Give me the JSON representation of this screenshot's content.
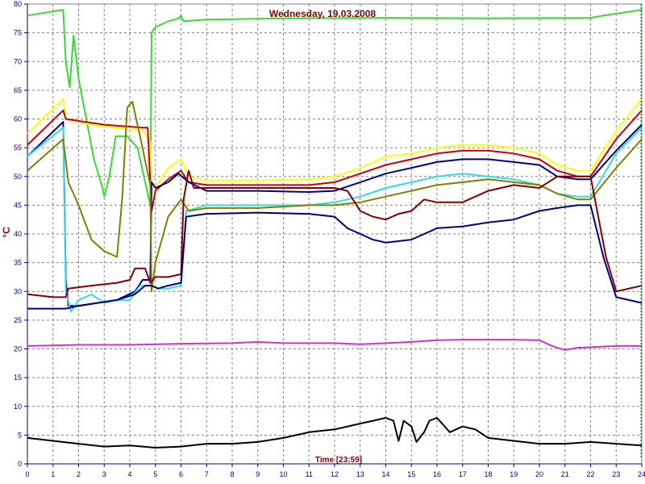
{
  "chart_data": {
    "type": "line",
    "title": "Wednesday, 19.03.2008",
    "xlabel": "Time [23:59]",
    "ylabel": "°C",
    "xlim": [
      0,
      24
    ],
    "ylim": [
      0,
      80
    ],
    "x_ticks": [
      0,
      1,
      2,
      3,
      4,
      5,
      6,
      7,
      8,
      9,
      10,
      11,
      12,
      13,
      14,
      15,
      16,
      17,
      18,
      19,
      20,
      21,
      22,
      23,
      24
    ],
    "y_ticks": [
      0,
      5,
      10,
      15,
      20,
      25,
      30,
      35,
      40,
      45,
      50,
      55,
      60,
      65,
      70,
      75,
      80
    ],
    "grid": true,
    "colors": {
      "grid": "#808080",
      "axis": "#000080",
      "title": "#800000",
      "marker": "#008000"
    },
    "series": [
      {
        "color": "#33dd33",
        "points": [
          [
            0,
            78
          ],
          [
            1.4,
            79
          ],
          [
            1.5,
            70
          ],
          [
            1.65,
            65.5
          ],
          [
            1.8,
            74.5
          ],
          [
            2.0,
            67
          ],
          [
            2.6,
            53
          ],
          [
            2.9,
            48.5
          ],
          [
            3.0,
            46.5
          ],
          [
            3.2,
            50
          ],
          [
            3.45,
            57
          ],
          [
            3.9,
            57
          ],
          [
            4.3,
            55
          ],
          [
            4.6,
            49
          ],
          [
            4.8,
            45
          ],
          [
            4.85,
            75
          ],
          [
            5.0,
            76
          ],
          [
            5.5,
            77
          ],
          [
            5.9,
            77.5
          ],
          [
            6.0,
            78
          ],
          [
            6.1,
            77
          ],
          [
            7,
            77.3
          ],
          [
            10,
            77.5
          ],
          [
            14,
            77.6
          ],
          [
            18,
            77.5
          ],
          [
            22,
            77.6
          ],
          [
            22.5,
            78
          ],
          [
            24,
            79
          ]
        ]
      },
      {
        "color": "#ffff00",
        "points": [
          [
            0,
            57.5
          ],
          [
            1.4,
            63.5
          ],
          [
            1.5,
            60
          ],
          [
            2.5,
            59
          ],
          [
            3.5,
            58.5
          ],
          [
            4.5,
            58
          ],
          [
            4.8,
            56
          ],
          [
            4.85,
            47
          ],
          [
            5.0,
            48
          ],
          [
            5.5,
            51.5
          ],
          [
            6.0,
            53
          ],
          [
            6.3,
            50
          ],
          [
            7,
            49.3
          ],
          [
            9,
            49.3
          ],
          [
            11,
            49.5
          ],
          [
            12,
            50
          ],
          [
            13,
            51.5
          ],
          [
            14,
            53.5
          ],
          [
            15,
            54
          ],
          [
            16,
            55
          ],
          [
            17,
            55.5
          ],
          [
            18,
            55.5
          ],
          [
            19,
            55
          ],
          [
            20,
            54
          ],
          [
            20.7,
            52
          ],
          [
            21.5,
            51
          ],
          [
            22,
            51
          ],
          [
            23,
            58
          ],
          [
            24,
            63.5
          ]
        ]
      },
      {
        "color": "#cc0000",
        "points": [
          [
            0,
            55.5
          ],
          [
            1.4,
            61.5
          ],
          [
            1.5,
            60
          ],
          [
            3,
            59
          ],
          [
            4.5,
            58.5
          ],
          [
            4.7,
            58.5
          ],
          [
            4.85,
            44
          ],
          [
            5.0,
            47.5
          ],
          [
            5.5,
            49.5
          ],
          [
            6.0,
            51
          ],
          [
            6.3,
            49
          ],
          [
            7,
            48.5
          ],
          [
            9,
            48.5
          ],
          [
            11,
            48.5
          ],
          [
            12,
            49
          ],
          [
            13,
            50.5
          ],
          [
            14,
            52
          ],
          [
            15,
            53
          ],
          [
            16,
            54
          ],
          [
            17,
            54.5
          ],
          [
            18,
            54.5
          ],
          [
            19,
            54
          ],
          [
            20,
            53
          ],
          [
            20.7,
            51
          ],
          [
            21.5,
            50
          ],
          [
            22,
            50
          ],
          [
            23,
            56.5
          ],
          [
            24,
            61.5
          ]
        ]
      },
      {
        "color": "#00008b",
        "points": [
          [
            0,
            53.5
          ],
          [
            1.4,
            59.5
          ],
          [
            1.5,
            32
          ],
          [
            1.6,
            27.5
          ],
          [
            2,
            27.5
          ],
          [
            3.5,
            28.5
          ],
          [
            4.2,
            30
          ],
          [
            4.5,
            32
          ],
          [
            4.8,
            32
          ],
          [
            4.85,
            49
          ],
          [
            5.0,
            48
          ],
          [
            5.5,
            49
          ],
          [
            5.9,
            50.5
          ],
          [
            6.3,
            49
          ],
          [
            7,
            47.5
          ],
          [
            9,
            47.5
          ],
          [
            11,
            47.3
          ],
          [
            12,
            47.5
          ],
          [
            13,
            49
          ],
          [
            14,
            50.5
          ],
          [
            15,
            51.5
          ],
          [
            16,
            52.5
          ],
          [
            17,
            53
          ],
          [
            18,
            53
          ],
          [
            19,
            52.5
          ],
          [
            20,
            52
          ],
          [
            20.7,
            50
          ],
          [
            21.5,
            49.5
          ],
          [
            22,
            49.5
          ],
          [
            23,
            54.5
          ],
          [
            24,
            59
          ]
        ]
      },
      {
        "color": "#33dddd",
        "points": [
          [
            0,
            53.5
          ],
          [
            1.4,
            58.5
          ],
          [
            1.5,
            30
          ],
          [
            1.7,
            26.5
          ],
          [
            2,
            28.5
          ],
          [
            2.5,
            29.5
          ],
          [
            3,
            28
          ],
          [
            3.5,
            28.5
          ],
          [
            4.0,
            28.5
          ],
          [
            4.4,
            31
          ],
          [
            4.8,
            31
          ],
          [
            4.85,
            31
          ],
          [
            5.1,
            30.5
          ],
          [
            5.5,
            30.5
          ],
          [
            6.0,
            31
          ],
          [
            6.2,
            44
          ],
          [
            7,
            45
          ],
          [
            9,
            45
          ],
          [
            11,
            45
          ],
          [
            12,
            45.5
          ],
          [
            13,
            46.5
          ],
          [
            14,
            48
          ],
          [
            15,
            49
          ],
          [
            16,
            50
          ],
          [
            17,
            50.5
          ],
          [
            18,
            50
          ],
          [
            19,
            49.5
          ],
          [
            20,
            48.5
          ],
          [
            20.7,
            47
          ],
          [
            21.5,
            46.5
          ],
          [
            22,
            46.5
          ],
          [
            23,
            54
          ],
          [
            24,
            58.5
          ]
        ]
      },
      {
        "color": "#808000",
        "points": [
          [
            0,
            51
          ],
          [
            1.4,
            56.5
          ],
          [
            1.6,
            49
          ],
          [
            2,
            45
          ],
          [
            2.5,
            39
          ],
          [
            3.0,
            37
          ],
          [
            3.5,
            36
          ],
          [
            3.7,
            46
          ],
          [
            3.9,
            62
          ],
          [
            4.1,
            63
          ],
          [
            4.4,
            57
          ],
          [
            4.8,
            48.5
          ],
          [
            4.85,
            30
          ],
          [
            5.0,
            35
          ],
          [
            5.5,
            43
          ],
          [
            6.0,
            46
          ],
          [
            6.3,
            44
          ],
          [
            7,
            44.5
          ],
          [
            9,
            44.5
          ],
          [
            11,
            45
          ],
          [
            12,
            45
          ],
          [
            13,
            45.5
          ],
          [
            14,
            46.5
          ],
          [
            15,
            47.5
          ],
          [
            16,
            48.5
          ],
          [
            17,
            49
          ],
          [
            18,
            49.5
          ],
          [
            19,
            49
          ],
          [
            20,
            48.5
          ],
          [
            20.7,
            47
          ],
          [
            21.5,
            46
          ],
          [
            22,
            46
          ],
          [
            23,
            51.5
          ],
          [
            24,
            56.5
          ]
        ]
      },
      {
        "color": "#800000",
        "points": [
          [
            0,
            29.5
          ],
          [
            1.0,
            29
          ],
          [
            1.5,
            29
          ],
          [
            1.6,
            30.5
          ],
          [
            2.5,
            31
          ],
          [
            3.5,
            31.5
          ],
          [
            4.0,
            32
          ],
          [
            4.2,
            34
          ],
          [
            4.6,
            34
          ],
          [
            4.8,
            31.5
          ],
          [
            5.0,
            32.5
          ],
          [
            5.5,
            32.5
          ],
          [
            6.0,
            33
          ],
          [
            6.1,
            46
          ],
          [
            6.3,
            51
          ],
          [
            6.5,
            48
          ],
          [
            7,
            48
          ],
          [
            9,
            48
          ],
          [
            11,
            48
          ],
          [
            12,
            48
          ],
          [
            12.5,
            47.5
          ],
          [
            13,
            44
          ],
          [
            13.5,
            43
          ],
          [
            14,
            42.5
          ],
          [
            14.5,
            43.5
          ],
          [
            15,
            44
          ],
          [
            15.5,
            46
          ],
          [
            16,
            45.5
          ],
          [
            17,
            45.5
          ],
          [
            17.5,
            46.5
          ],
          [
            18,
            47.5
          ],
          [
            19,
            48.5
          ],
          [
            20,
            48
          ],
          [
            20.7,
            50
          ],
          [
            21.5,
            50
          ],
          [
            22,
            50
          ],
          [
            22.6,
            36
          ],
          [
            23,
            30
          ],
          [
            24,
            31
          ]
        ]
      },
      {
        "color": "#000080",
        "points": [
          [
            0,
            27
          ],
          [
            1.0,
            27
          ],
          [
            1.5,
            27
          ],
          [
            2,
            27.5
          ],
          [
            3.5,
            28.5
          ],
          [
            4.2,
            29.5
          ],
          [
            4.6,
            31
          ],
          [
            4.85,
            31
          ],
          [
            5.1,
            30.5
          ],
          [
            5.5,
            31
          ],
          [
            6.0,
            31.5
          ],
          [
            6.2,
            43
          ],
          [
            7,
            43.5
          ],
          [
            9,
            43.7
          ],
          [
            11,
            43.5
          ],
          [
            12,
            43
          ],
          [
            12.5,
            41
          ],
          [
            13,
            40
          ],
          [
            13.5,
            39
          ],
          [
            14,
            38.5
          ],
          [
            15,
            39
          ],
          [
            15.5,
            40
          ],
          [
            16,
            41
          ],
          [
            17,
            41.3
          ],
          [
            18,
            42
          ],
          [
            19,
            42.5
          ],
          [
            20,
            44
          ],
          [
            20.7,
            44.5
          ],
          [
            21.5,
            45
          ],
          [
            22,
            45
          ],
          [
            22.5,
            36
          ],
          [
            23,
            29
          ],
          [
            24,
            28
          ]
        ]
      },
      {
        "color": "#cc33cc",
        "points": [
          [
            0,
            20.5
          ],
          [
            2,
            20.7
          ],
          [
            4,
            20.7
          ],
          [
            6,
            20.9
          ],
          [
            8,
            21
          ],
          [
            9,
            21.2
          ],
          [
            10,
            21
          ],
          [
            12,
            21
          ],
          [
            13,
            20.8
          ],
          [
            14,
            21
          ],
          [
            15,
            21.2
          ],
          [
            16,
            21.5
          ],
          [
            17,
            21.6
          ],
          [
            18,
            21.6
          ],
          [
            19,
            21.6
          ],
          [
            20,
            21.5
          ],
          [
            20.5,
            20.5
          ],
          [
            21,
            19.8
          ],
          [
            21.5,
            20.2
          ],
          [
            22,
            20.3
          ],
          [
            23,
            20.5
          ],
          [
            24,
            20.5
          ]
        ]
      },
      {
        "color": "#000000",
        "points": [
          [
            0,
            4.5
          ],
          [
            1,
            4.0
          ],
          [
            2,
            3.5
          ],
          [
            3,
            3.0
          ],
          [
            4,
            3.2
          ],
          [
            5,
            2.8
          ],
          [
            6,
            3.0
          ],
          [
            7,
            3.5
          ],
          [
            8,
            3.5
          ],
          [
            9,
            3.8
          ],
          [
            10,
            4.5
          ],
          [
            11,
            5.5
          ],
          [
            12,
            6.0
          ],
          [
            13,
            7.0
          ],
          [
            13.5,
            7.5
          ],
          [
            14,
            8.0
          ],
          [
            14.3,
            7.5
          ],
          [
            14.5,
            4.0
          ],
          [
            14.7,
            7.5
          ],
          [
            15,
            6.5
          ],
          [
            15.2,
            3.8
          ],
          [
            15.5,
            5.5
          ],
          [
            15.7,
            7.5
          ],
          [
            16,
            8.0
          ],
          [
            16.5,
            5.5
          ],
          [
            17,
            6.5
          ],
          [
            17.5,
            6.0
          ],
          [
            18,
            4.5
          ],
          [
            19,
            4.0
          ],
          [
            20,
            3.5
          ],
          [
            21,
            3.5
          ],
          [
            22,
            3.8
          ],
          [
            23,
            3.5
          ],
          [
            24,
            3.2
          ]
        ]
      }
    ],
    "markers": [
      [
        24,
        1.0
      ]
    ]
  }
}
